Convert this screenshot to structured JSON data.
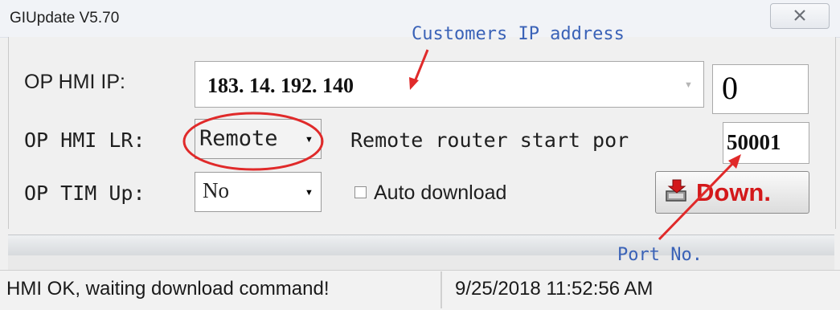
{
  "window": {
    "title": "GIUpdate V5.70",
    "close_icon": "close-x-icon"
  },
  "form": {
    "ip_label": "OP HMI IP:",
    "ip_value": "183. 14. 192. 140",
    "ip_index_value": "0",
    "lr_label": "OP HMI LR:",
    "lr_value": "Remote",
    "remote_port_label": "Remote router start por",
    "remote_port_value": "50001",
    "tim_label": "OP TIM Up:",
    "tim_value": "No",
    "auto_download_label": "Auto download",
    "auto_download_checked": false,
    "down_button_label": "Down.",
    "down_button_icon": "download-icon"
  },
  "status": {
    "message": "HMI OK, waiting download command!",
    "timestamp": "9/25/2018  11:52:56 AM"
  },
  "annotations": {
    "customers_ip": "Customers IP address",
    "port_no": "Port No.",
    "color": "#3a62b7",
    "marker_color": "#e02a2a"
  }
}
